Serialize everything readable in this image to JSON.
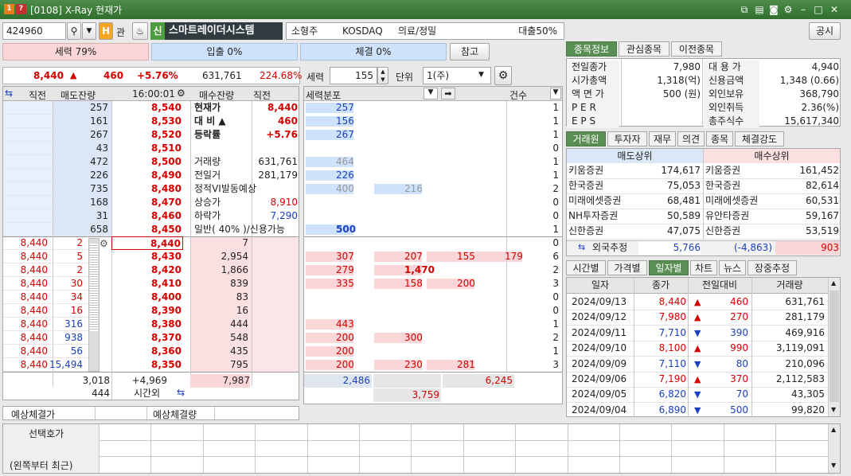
{
  "title": {
    "badge": "1",
    "code": "[0108] X-Ray 현재가"
  },
  "search": {
    "code": "424960",
    "gwan": "관",
    "sin": "신",
    "name": "스마트레이더시스템",
    "size": "소형주",
    "market": "KOSDAQ",
    "sector": "의료/정밀",
    "loan": "대출50%",
    "notice": "공시"
  },
  "strength": {
    "label": "세력 79%",
    "inflow": "입출 0%",
    "exec": "체결 0%",
    "ref": "참고"
  },
  "price_row": {
    "price": "8,440",
    "arrow": "▲",
    "change": "460",
    "rate": "+5.76%",
    "volume": "631,761",
    "vol_rate": "224.68%"
  },
  "seryeok": {
    "label": "세력",
    "value": "155",
    "unit_label": "단위",
    "unit": "1(주)"
  },
  "ob_header": {
    "prev": "직전",
    "sell": "매도잔량",
    "time": "16:00:01",
    "buy": "매수잔량",
    "prev2": "직전"
  },
  "asks": [
    {
      "qty": "257",
      "price": "8,540"
    },
    {
      "qty": "161",
      "price": "8,530"
    },
    {
      "qty": "267",
      "price": "8,520"
    },
    {
      "qty": "43",
      "price": "8,510"
    },
    {
      "qty": "472",
      "price": "8,500"
    },
    {
      "qty": "226",
      "price": "8,490"
    },
    {
      "qty": "735",
      "price": "8,480"
    },
    {
      "qty": "168",
      "price": "8,470"
    },
    {
      "qty": "31",
      "price": "8,460"
    },
    {
      "qty": "658",
      "price": "8,450"
    }
  ],
  "ask_info": [
    {
      "label": "현재가",
      "value": "8,440",
      "cls": "red"
    },
    {
      "label": "대 비 ▲",
      "value": "460",
      "cls": "red"
    },
    {
      "label": "등락률",
      "value": "+5.76",
      "cls": "red"
    },
    {
      "label": "",
      "value": "",
      "cls": ""
    },
    {
      "label": "거래량",
      "value": "631,761",
      "cls": ""
    },
    {
      "label": "전일거",
      "value": "281,179",
      "cls": ""
    },
    {
      "label": "정적VI발동예상",
      "value": "",
      "cls": ""
    },
    {
      "label": "상승가",
      "value": "8,910",
      "cls": "red"
    },
    {
      "label": "하락가",
      "value": "7,290",
      "cls": "blue"
    },
    {
      "label": "일반( 40% )/신용가능",
      "value": "",
      "cls": ""
    }
  ],
  "bids": [
    {
      "prev": "8,440",
      "pq": "2",
      "price": "8,440",
      "qty": "7"
    },
    {
      "prev": "8,440",
      "pq": "5",
      "price": "8,430",
      "qty": "2,954"
    },
    {
      "prev": "8,440",
      "pq": "2",
      "price": "8,420",
      "qty": "1,866"
    },
    {
      "prev": "8,440",
      "pq": "30",
      "price": "8,410",
      "qty": "839"
    },
    {
      "prev": "8,440",
      "pq": "34",
      "price": "8,400",
      "qty": "83"
    },
    {
      "prev": "8,440",
      "pq": "16",
      "price": "8,390",
      "qty": "16"
    },
    {
      "prev": "8,440",
      "pq": "316",
      "price": "8,380",
      "qty": "444"
    },
    {
      "prev": "8,440",
      "pq": "938",
      "price": "8,370",
      "qty": "548"
    },
    {
      "prev": "8,440",
      "pq": "56",
      "price": "8,360",
      "qty": "435"
    },
    {
      "prev": "8,440",
      "pq": "15,494",
      "price": "8,350",
      "qty": "795"
    }
  ],
  "ob_total": {
    "sell": "3,018",
    "diff": "+4,969",
    "buy": "7,987",
    "after": "444",
    "after_label": "시간외"
  },
  "expect": {
    "price": "예상체결가",
    "qty": "예상체결량"
  },
  "dist_header": {
    "label": "세력분포",
    "count": "건수"
  },
  "dist_ask": [
    {
      "v": [
        "257"
      ],
      "c": "1"
    },
    {
      "v": [
        "156"
      ],
      "c": "1"
    },
    {
      "v": [
        "267"
      ],
      "c": "1"
    },
    {
      "v": [
        ""
      ],
      "c": "0"
    },
    {
      "v": [
        "464"
      ],
      "c": "1"
    },
    {
      "v": [
        "226"
      ],
      "c": "1"
    },
    {
      "v": [
        "400",
        "216"
      ],
      "c": "2"
    },
    {
      "v": [
        ""
      ],
      "c": "0"
    },
    {
      "v": [
        ""
      ],
      "c": "0"
    },
    {
      "v": [
        "500"
      ],
      "c": "1"
    }
  ],
  "dist_bid": [
    {
      "v": [
        ""
      ],
      "c": "0"
    },
    {
      "v": [
        "307",
        "207",
        "155",
        "179"
      ],
      "c": "6"
    },
    {
      "v": [
        "279",
        "1,470"
      ],
      "c": "2"
    },
    {
      "v": [
        "335",
        "158",
        "200"
      ],
      "c": "3"
    },
    {
      "v": [
        ""
      ],
      "c": "0"
    },
    {
      "v": [
        ""
      ],
      "c": "0"
    },
    {
      "v": [
        "443"
      ],
      "c": "1"
    },
    {
      "v": [
        "200",
        "300"
      ],
      "c": "2"
    },
    {
      "v": [
        "200"
      ],
      "c": "1"
    },
    {
      "v": [
        "200",
        "230",
        "281"
      ],
      "c": "3"
    }
  ],
  "dist_total": {
    "sell": "2,486",
    "buy": "6,245",
    "net": "3,759"
  },
  "info_tabs": [
    "종목정보",
    "관심종목",
    "이전종목"
  ],
  "info": [
    {
      "l1": "전일종가",
      "v1": "7,980",
      "l2": "대 용 가",
      "v2": "4,940"
    },
    {
      "l1": "시가총액",
      "v1": "1,318(억)",
      "l2": "신용금액",
      "v2": "1,348  (0.66)"
    },
    {
      "l1": "액 면 가",
      "v1": "500 (원)",
      "l2": "외인보유",
      "v2": "368,790"
    },
    {
      "l1": "P E R",
      "v1": "",
      "l2": "외인취득",
      "v2": "2.36(%)"
    },
    {
      "l1": "E P S",
      "v1": "",
      "l2": "총주식수",
      "v2": "15,617,340"
    }
  ],
  "broker_tabs": [
    "거래원",
    "투자자",
    "재무",
    "의견",
    "종목",
    "체결강도"
  ],
  "broker_header": {
    "sell": "매도상위",
    "buy": "매수상위"
  },
  "brokers": [
    {
      "s": "키움증권",
      "sv": "174,617",
      "b": "키움증권",
      "bv": "161,452"
    },
    {
      "s": "한국증권",
      "sv": "75,053",
      "b": "한국증권",
      "bv": "82,614"
    },
    {
      "s": "미래에셋증권",
      "sv": "68,481",
      "b": "미래에셋증권",
      "bv": "60,531"
    },
    {
      "s": "NH투자증권",
      "sv": "50,589",
      "b": "유안타증권",
      "bv": "59,167"
    },
    {
      "s": "신한증권",
      "sv": "47,075",
      "b": "신한증권",
      "bv": "53,519"
    }
  ],
  "foreign": {
    "label": "외국추정",
    "sell": "5,766",
    "diff": "(-4,863)",
    "buy": "903"
  },
  "daily_tabs": [
    "시간별",
    "가격별",
    "일자별",
    "차트",
    "뉴스",
    "장중추정"
  ],
  "daily_header": [
    "일자",
    "종가",
    "전일대비",
    "거래량"
  ],
  "daily": [
    {
      "d": "2024/09/13",
      "p": "8,440",
      "a": "▲",
      "c": "460",
      "v": "631,761",
      "dir": "up"
    },
    {
      "d": "2024/09/12",
      "p": "7,980",
      "a": "▲",
      "c": "270",
      "v": "281,179",
      "dir": "up"
    },
    {
      "d": "2024/09/11",
      "p": "7,710",
      "a": "▼",
      "c": "390",
      "v": "469,916",
      "dir": "down"
    },
    {
      "d": "2024/09/10",
      "p": "8,100",
      "a": "▲",
      "c": "990",
      "v": "3,119,091",
      "dir": "up"
    },
    {
      "d": "2024/09/09",
      "p": "7,110",
      "a": "▼",
      "c": "80",
      "v": "210,096",
      "dir": "down"
    },
    {
      "d": "2024/09/06",
      "p": "7,190",
      "a": "▲",
      "c": "370",
      "v": "2,112,583",
      "dir": "up"
    },
    {
      "d": "2024/09/05",
      "p": "6,820",
      "a": "▼",
      "c": "70",
      "v": "43,305",
      "dir": "down"
    },
    {
      "d": "2024/09/04",
      "p": "6,890",
      "a": "▼",
      "c": "500",
      "v": "99,820",
      "dir": "down"
    }
  ],
  "bottom": {
    "label1": "선택호가",
    "label2": "(왼쪽부터 최근)"
  }
}
